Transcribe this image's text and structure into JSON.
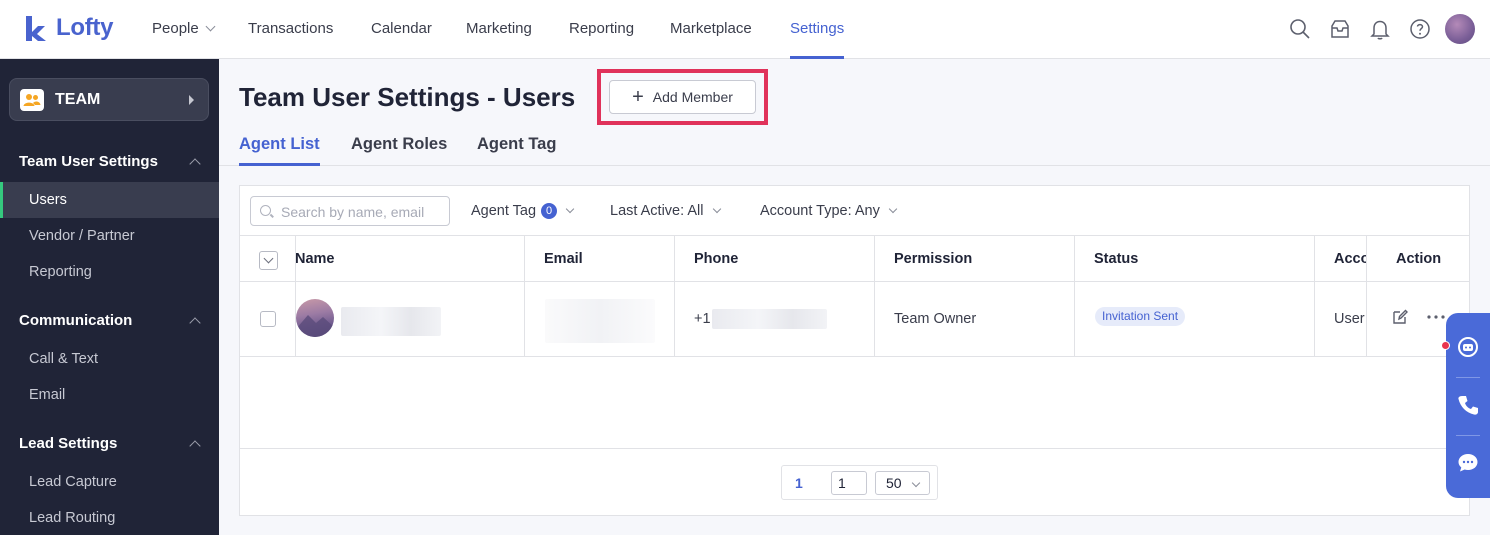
{
  "app": {
    "logo_text": "Lofty",
    "brand_color": "#4562d1"
  },
  "topnav": {
    "items": [
      {
        "label": "People",
        "has_dropdown": true
      },
      {
        "label": "Transactions"
      },
      {
        "label": "Calendar"
      },
      {
        "label": "Marketing"
      },
      {
        "label": "Reporting"
      },
      {
        "label": "Marketplace"
      },
      {
        "label": "Settings",
        "active": true
      }
    ],
    "icons": [
      "search-icon",
      "inbox-icon",
      "bell-icon",
      "help-icon",
      "user-avatar"
    ]
  },
  "sidebar": {
    "team_label": "TEAM",
    "sections": [
      {
        "title": "Team User Settings",
        "items": [
          "Users",
          "Vendor / Partner",
          "Reporting"
        ]
      },
      {
        "title": "Communication",
        "items": [
          "Call & Text",
          "Email"
        ]
      },
      {
        "title": "Lead Settings",
        "items": [
          "Lead Capture",
          "Lead Routing"
        ]
      }
    ],
    "active_item": "Users"
  },
  "main": {
    "title": "Team User Settings - Users",
    "add_button_label": "Add Member",
    "tabs": [
      {
        "label": "Agent List",
        "active": true
      },
      {
        "label": "Agent Roles"
      },
      {
        "label": "Agent Tag"
      }
    ]
  },
  "filters": {
    "search_placeholder": "Search by name, email",
    "agent_tag_label": "Agent Tag",
    "agent_tag_count": "0",
    "last_active_label": "Last Active: All",
    "account_type_label": "Account Type: Any"
  },
  "table": {
    "columns": [
      "Name",
      "Email",
      "Phone",
      "Permission",
      "Status",
      "Acco",
      "Action"
    ],
    "rows": [
      {
        "name": "",
        "email": "",
        "phone_prefix": "+1",
        "permission": "Team Owner",
        "status": "Invitation Sent",
        "account": "User"
      }
    ]
  },
  "pagination": {
    "current_page": "1",
    "page_input": "1",
    "page_size": "50"
  }
}
